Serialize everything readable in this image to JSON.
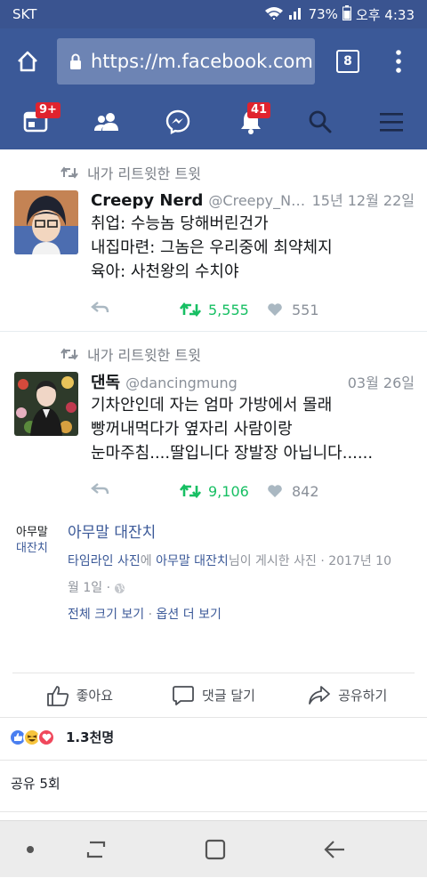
{
  "status_bar": {
    "carrier": "SKT",
    "battery": "73%",
    "time": "오후 4:33"
  },
  "browser": {
    "url": "https://m.facebook.com",
    "tab_count": "8"
  },
  "fb_nav": {
    "home_badge": "9+",
    "notif_badge": "41"
  },
  "tweets": [
    {
      "retweet_label": "내가 리트윗한 트윗",
      "name": "Creepy Nerd",
      "handle": "@Creepy_N…",
      "date": "15년 12월 22일",
      "lines": [
        "취업: 수능놈 당해버린건가",
        "내집마련: 그놈은 우리중에 최약체지",
        "육아: 사천왕의 수치야"
      ],
      "retweets": "5,555",
      "likes": "551"
    },
    {
      "retweet_label": "내가 리트윗한 트윗",
      "name": "댄독",
      "handle": "@dancingmung",
      "date": "03월 26일",
      "lines": [
        "기차안인데 자는 엄마 가방에서 몰래",
        "빵꺼내먹다가 옆자리 사람이랑",
        "눈마주침....딸입니다 장발장 아닙니다......"
      ],
      "retweets": "9,106",
      "likes": "842"
    }
  ],
  "caption": {
    "label_line1": "아무말",
    "label_line2": "대잔치",
    "title": "아무말 대잔치",
    "desc_part1": "타임라인 사진",
    "desc_part2": "에 ",
    "desc_part3": "아무말 대잔치",
    "desc_part4": "님이 게시한 사진 · 2017년 10",
    "desc_line2": "월 1일 ·",
    "full_size": "전체 크기 보기",
    "dot": " · ",
    "more_options": "옵션 더 보기"
  },
  "post_actions": {
    "like": "좋아요",
    "comment": "댓글 달기",
    "share": "공유하기"
  },
  "reactions": {
    "count": "1.3천명"
  },
  "shares": "공유 5회",
  "colors": {
    "facebook_blue": "#3b5998",
    "retweet_green": "#17bf63",
    "badge_red": "#e0232e"
  }
}
